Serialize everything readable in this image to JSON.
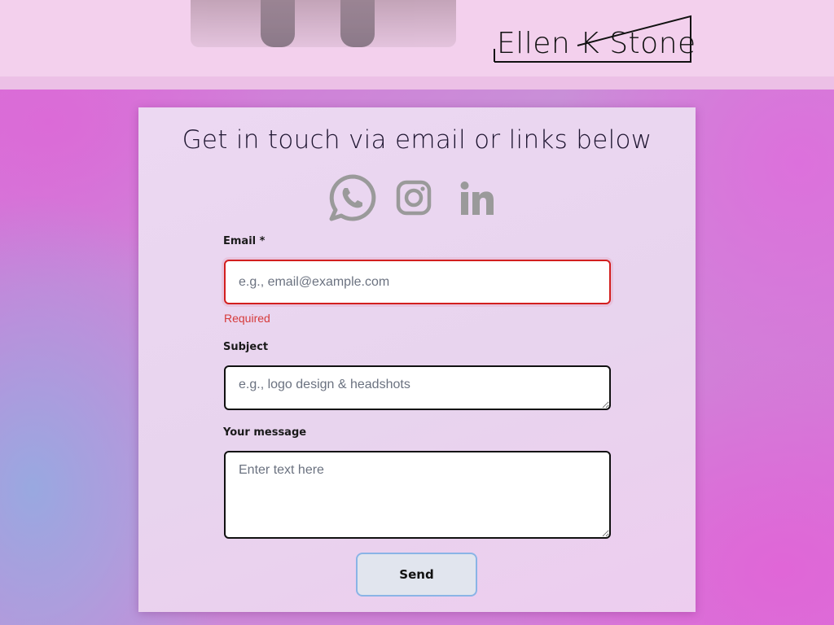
{
  "header": {
    "logo_text": "Ellen K Stone"
  },
  "contact": {
    "title": "Get in touch via email or links below",
    "social": [
      {
        "icon": "whatsapp-icon"
      },
      {
        "icon": "instagram-icon"
      },
      {
        "icon": "linkedin-icon"
      }
    ],
    "icon_color": "#9a9a9a",
    "form": {
      "email_label": "Email *",
      "email_placeholder": "e.g., email@example.com",
      "email_value": "",
      "email_error": "Required",
      "subject_label": "Subject",
      "subject_placeholder": "e.g., logo design & headshots",
      "subject_value": "",
      "message_label": "Your message",
      "message_placeholder": "Enter text here",
      "message_value": "",
      "send_label": "Send"
    }
  },
  "colors": {
    "error": "#d21f1f",
    "send_border": "#8ab4e6",
    "card_background": "#ecd8f2"
  }
}
